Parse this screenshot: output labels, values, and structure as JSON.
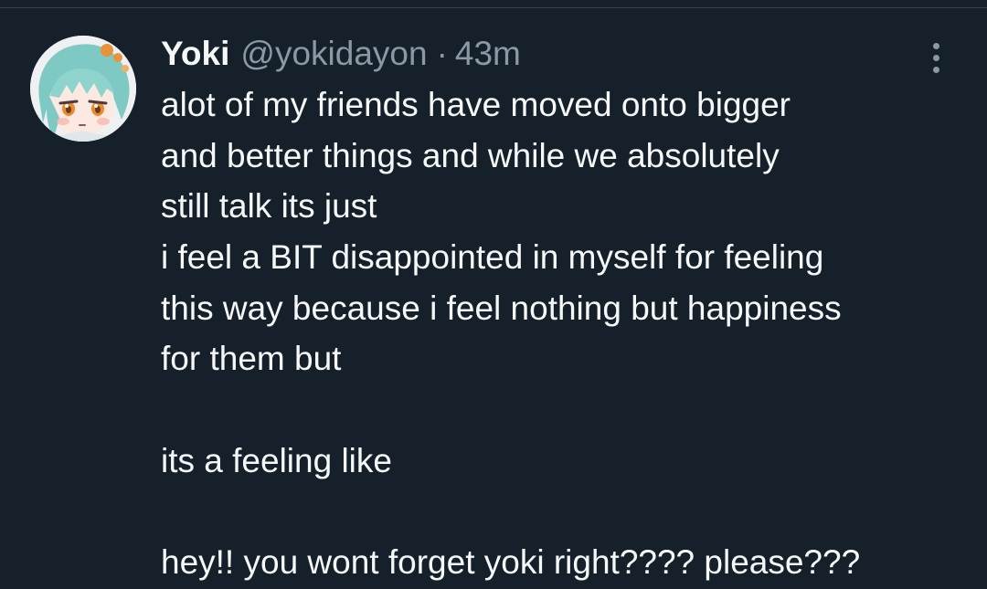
{
  "tweet": {
    "display_name": "Yoki",
    "handle": "@yokidayon",
    "separator": "·",
    "time": "43m",
    "avatar_icon": "anime-avatar-icon",
    "more_icon": "more-options-icon",
    "lines": [
      "alot of my friends have moved onto bigger",
      "and better things and while we absolutely",
      "still talk its just",
      "i feel a BIT disappointed in myself for feeling",
      "this way because i feel nothing but happiness",
      "for them but",
      "",
      "its a feeling like",
      "",
      "hey!! you wont forget yoki right???? please???"
    ]
  },
  "colors": {
    "background": "#15202b",
    "text": "#f7f9f9",
    "secondary_text": "#8b98a5",
    "divider": "#38444d"
  }
}
